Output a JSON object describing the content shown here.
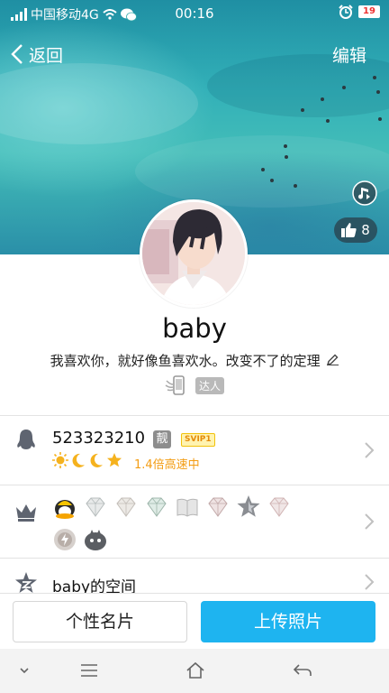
{
  "status_bar": {
    "carrier": "中国移动4G",
    "time": "00:16",
    "battery": "19"
  },
  "nav": {
    "back_label": "返回",
    "edit_label": "编辑"
  },
  "likes": {
    "count": "8"
  },
  "profile": {
    "nickname": "baby",
    "signature": "我喜欢你，就好像鱼喜欢水。改变不了的定理",
    "daren_label": "达人"
  },
  "qq_row": {
    "number": "523323210",
    "liang_label": "靓",
    "svip_label": "SVIP1",
    "speed_text": "1.4倍高速中"
  },
  "zone_row": {
    "label": "baby的空间"
  },
  "actions": {
    "card_label": "个性名片",
    "upload_label": "上传照片"
  },
  "colors": {
    "accent": "#1eb4f0",
    "speed": "#f39c12",
    "svip": "#e58c0a"
  }
}
